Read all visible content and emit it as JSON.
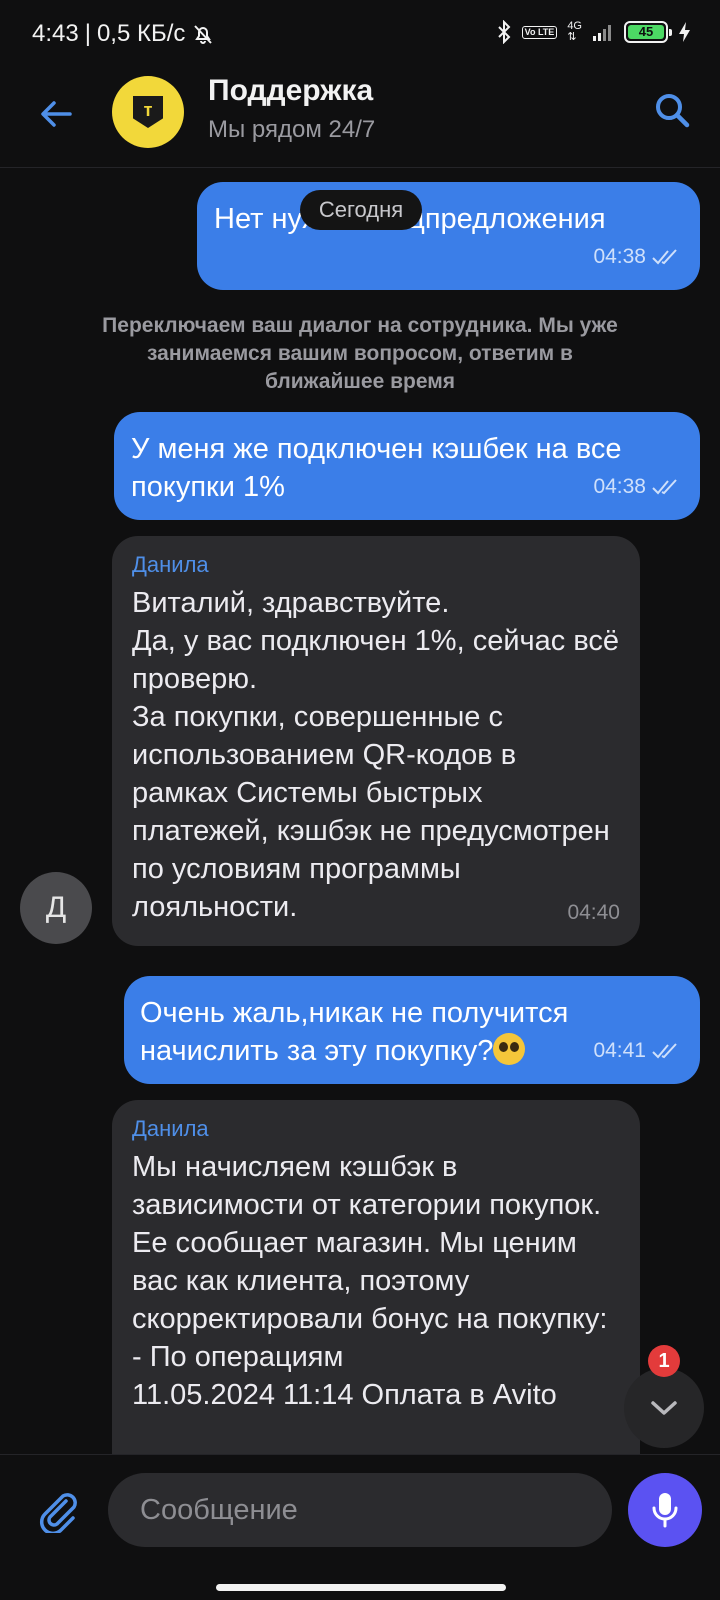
{
  "status_bar": {
    "time": "4:43",
    "separator": "|",
    "speed": "0,5 КБ/с",
    "volte": "Vo LTE",
    "network": "4G",
    "battery": "45"
  },
  "header": {
    "title": "Поддержка",
    "subtitle": "Мы рядом 24/7",
    "avatar_letter": "т"
  },
  "date_pill": "Сегодня",
  "messages": [
    {
      "direction": "out",
      "text": "Нет нужно спецпредложения",
      "time": "04:38"
    },
    {
      "direction": "system",
      "text": "Переключаем ваш диалог на сотрудника. Мы уже занимаемся вашим вопросом, ответим в ближайшее время"
    },
    {
      "direction": "out",
      "text": "У меня же подключен кэшбек на все покупки 1%",
      "time": "04:38"
    },
    {
      "direction": "in",
      "author": "Данила",
      "text": "Виталий, здравствуйте.\nДа, у вас подключен 1%, сейчас всё проверю.\nЗа покупки, совершенные с использованием QR-кодов в рамках Системы быстрых платежей, кэшбэк не предусмотрен по условиям программы лояльности.",
      "time": "04:40"
    },
    {
      "direction": "out",
      "text": "Очень жаль,никак не получится начислить за эту покупку?",
      "emoji": "pleading-face",
      "time": "04:41"
    },
    {
      "direction": "in",
      "author": "Данила",
      "text": "Мы начисляем кэшбэк в зависимости от категории покупок. Ее сообщает магазин. Мы ценим вас как клиента, поэтому скорректировали бонус на покупку:\n- По операциям\n11.05.2024 11:14 Оплата в Avito"
    }
  ],
  "sender_avatar_letter": "Д",
  "unread_count": "1",
  "composer": {
    "placeholder": "Сообщение"
  },
  "colors": {
    "background": "#0f0f10",
    "outgoing_bubble": "#3b7ee8",
    "incoming_bubble": "#2b2b2e",
    "accent": "#4f8fe8",
    "mic_button": "#5b52f2",
    "badge": "#e33b3b",
    "avatar_yellow": "#f2d83a"
  },
  "icons": [
    "back-arrow-icon",
    "search-icon",
    "double-check-icon",
    "chevron-down-icon",
    "paperclip-icon",
    "microphone-icon",
    "bluetooth-icon",
    "bell-off-icon",
    "signal-icon",
    "charging-icon"
  ]
}
